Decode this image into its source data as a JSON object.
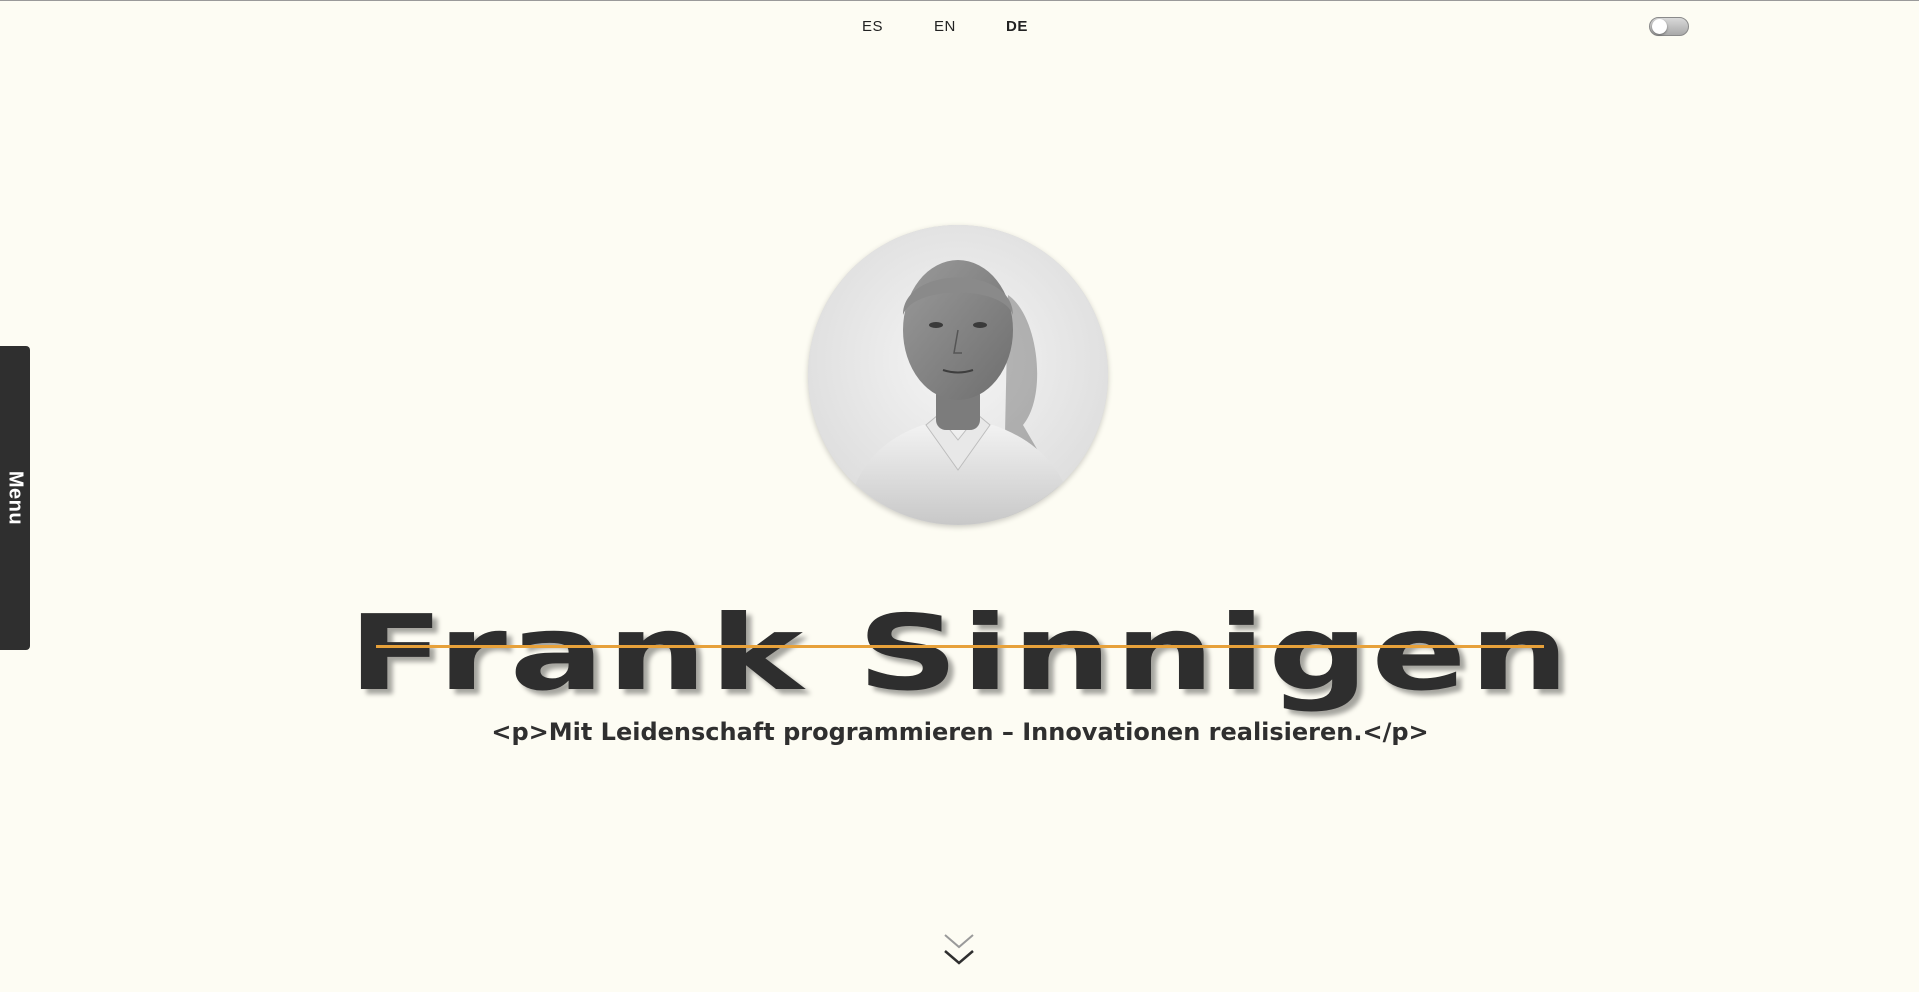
{
  "header": {
    "languages": [
      {
        "code": "ES",
        "active": false
      },
      {
        "code": "EN",
        "active": false
      },
      {
        "code": "DE",
        "active": true
      }
    ],
    "theme_toggle": {
      "state": "off"
    }
  },
  "sidebar": {
    "menu_label": "Menu"
  },
  "hero": {
    "name": "Frank Sinnigen",
    "tagline": "<p>Mit Leidenschaft programmieren – Innovationen realisieren.</p>",
    "underline_color": "#e7a13a",
    "avatar_icon": "profile-photo"
  },
  "scroll": {
    "icon": "double-chevron-down-icon"
  },
  "colors": {
    "background": "#fdfcf3",
    "text": "#2f2f2f",
    "accent": "#e7a13a",
    "sidebar": "#2f2f2f"
  }
}
